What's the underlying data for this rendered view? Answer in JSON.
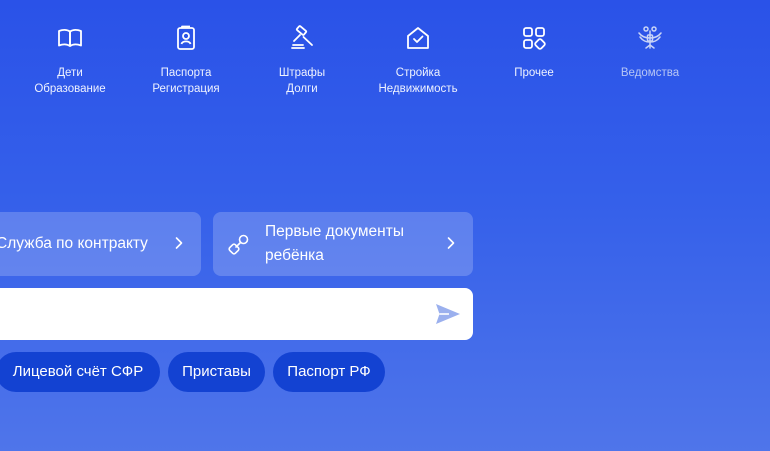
{
  "categories": [
    {
      "line1": "Дети",
      "line2": "Образование",
      "icon": "open-book-icon"
    },
    {
      "line1": "Паспорта",
      "line2": "Регистрация",
      "icon": "passport-icon"
    },
    {
      "line1": "Штрафы",
      "line2": "Долги",
      "icon": "gavel-icon"
    },
    {
      "line1": "Стройка",
      "line2": "Недвижимость",
      "icon": "house-check-icon"
    },
    {
      "line1": "Прочее",
      "line2": "",
      "icon": "grid-icon"
    },
    {
      "line1": "Ведомства",
      "line2": "",
      "icon": "eagle-emblem-icon"
    }
  ],
  "cards": [
    {
      "title": "Служба по контракту",
      "icon": "chevron-right-icon"
    },
    {
      "title_line1": "Первые документы",
      "title_line2": "ребёнка",
      "icon": "pacifier-icon"
    }
  ],
  "search": {
    "value": "",
    "placeholder": "",
    "send_icon": "send-arrow-icon"
  },
  "chips": [
    "Лицевой счёт СФР",
    "Приставы",
    "Паспорт РФ"
  ],
  "colors": {
    "background_top": "#2a52e8",
    "background_bottom": "#4f75ea",
    "chip": "#1342d2",
    "card": "rgba(255,255,255,0.2)"
  }
}
